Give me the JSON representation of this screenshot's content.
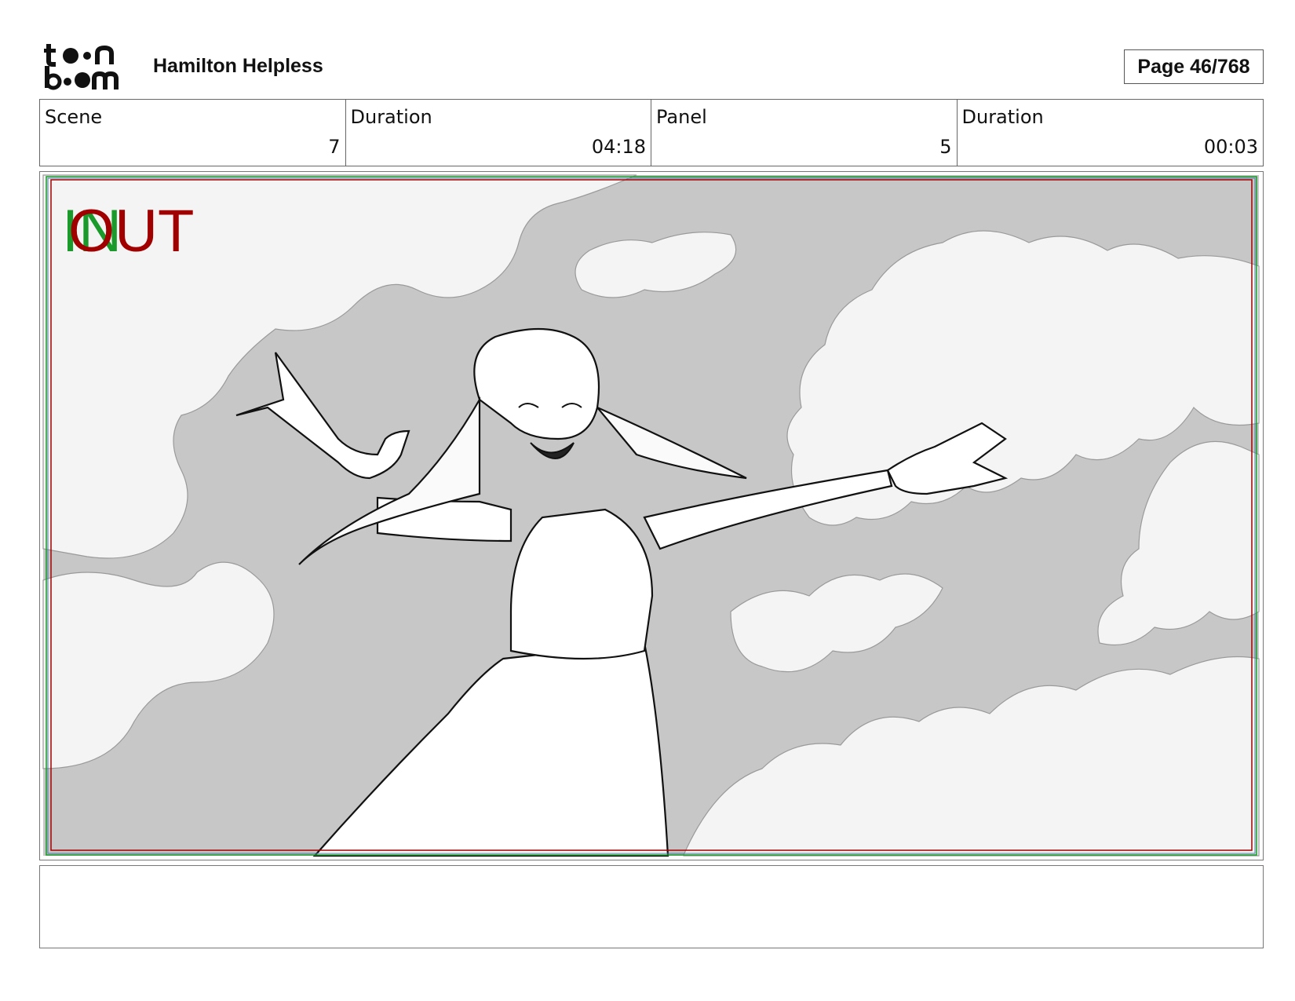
{
  "header": {
    "logo_text_top": "toon",
    "logo_text_bottom": "boom",
    "project_title": "Hamilton Helpless",
    "page_label": "Page  46/768"
  },
  "info": {
    "scene_label": "Scene",
    "scene_value": "7",
    "scene_duration_label": "Duration",
    "scene_duration_value": "04:18",
    "panel_label": "Panel",
    "panel_value": "5",
    "panel_duration_label": "Duration",
    "panel_duration_value": "00:03"
  },
  "panel": {
    "in_marker": "IN",
    "out_marker": "OUT",
    "in_color": "#1a9a2a",
    "out_color": "#a00000"
  },
  "notes": {
    "text": ""
  }
}
